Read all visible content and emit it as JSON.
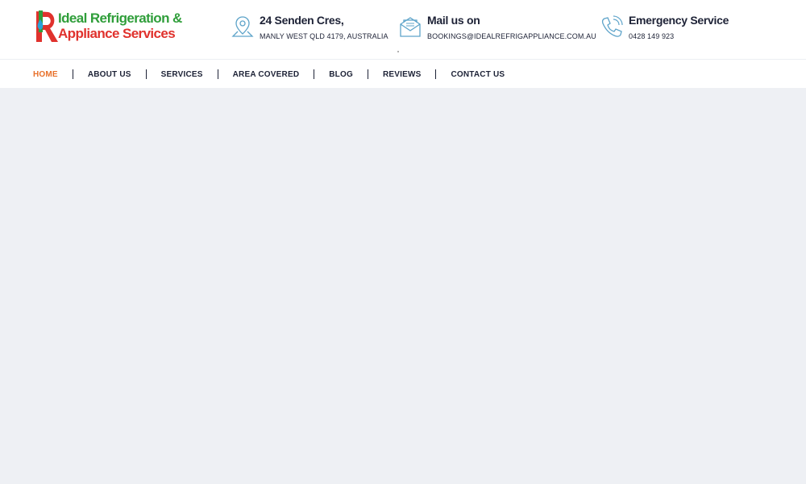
{
  "brand": {
    "line1": "Ideal Refrigeration &",
    "line2": "Appliance Services",
    "colors": {
      "green": "#2f9e3a",
      "red": "#e0322d",
      "drop": "#29a3d8"
    }
  },
  "contact": {
    "address": {
      "icon": "location-pin-icon",
      "title": "24 Senden Cres,",
      "sub": "MANLY WEST QLD 4179, AUSTRALIA"
    },
    "mail": {
      "icon": "envelope-icon",
      "title": "Mail us on",
      "sub": "BOOKINGS@IDEALREFRIGAPPLIANCE.COM.AU"
    },
    "phone": {
      "icon": "phone-icon",
      "title": "Emergency Service",
      "sub": "0428 149 923"
    },
    "icon_color": "#5da3c9"
  },
  "nav": {
    "items": [
      {
        "label": "HOME",
        "active": true
      },
      {
        "label": "ABOUT US"
      },
      {
        "label": "SERVICES"
      },
      {
        "label": "AREA COVERED"
      },
      {
        "label": "BLOG"
      },
      {
        "label": "REVIEWS"
      },
      {
        "label": "CONTACT US"
      }
    ],
    "active_color": "#e8702a"
  },
  "page": {
    "background": "#eef0f4"
  }
}
